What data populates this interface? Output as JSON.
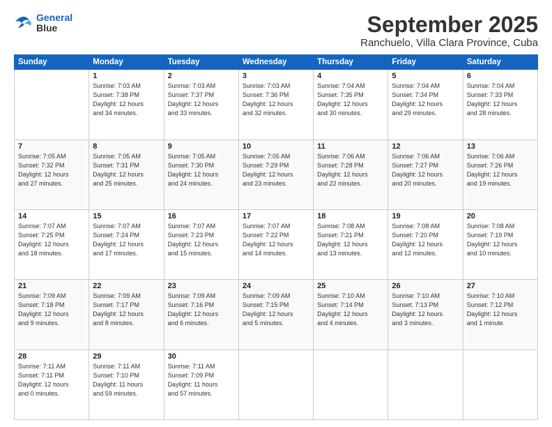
{
  "logo": {
    "line1": "General",
    "line2": "Blue"
  },
  "title": "September 2025",
  "subtitle": "Ranchuelo, Villa Clara Province, Cuba",
  "weekdays": [
    "Sunday",
    "Monday",
    "Tuesday",
    "Wednesday",
    "Thursday",
    "Friday",
    "Saturday"
  ],
  "weeks": [
    [
      {
        "day": "",
        "info": ""
      },
      {
        "day": "1",
        "info": "Sunrise: 7:03 AM\nSunset: 7:38 PM\nDaylight: 12 hours\nand 34 minutes."
      },
      {
        "day": "2",
        "info": "Sunrise: 7:03 AM\nSunset: 7:37 PM\nDaylight: 12 hours\nand 33 minutes."
      },
      {
        "day": "3",
        "info": "Sunrise: 7:03 AM\nSunset: 7:36 PM\nDaylight: 12 hours\nand 32 minutes."
      },
      {
        "day": "4",
        "info": "Sunrise: 7:04 AM\nSunset: 7:35 PM\nDaylight: 12 hours\nand 30 minutes."
      },
      {
        "day": "5",
        "info": "Sunrise: 7:04 AM\nSunset: 7:34 PM\nDaylight: 12 hours\nand 29 minutes."
      },
      {
        "day": "6",
        "info": "Sunrise: 7:04 AM\nSunset: 7:33 PM\nDaylight: 12 hours\nand 28 minutes."
      }
    ],
    [
      {
        "day": "7",
        "info": "Sunrise: 7:05 AM\nSunset: 7:32 PM\nDaylight: 12 hours\nand 27 minutes."
      },
      {
        "day": "8",
        "info": "Sunrise: 7:05 AM\nSunset: 7:31 PM\nDaylight: 12 hours\nand 25 minutes."
      },
      {
        "day": "9",
        "info": "Sunrise: 7:05 AM\nSunset: 7:30 PM\nDaylight: 12 hours\nand 24 minutes."
      },
      {
        "day": "10",
        "info": "Sunrise: 7:05 AM\nSunset: 7:29 PM\nDaylight: 12 hours\nand 23 minutes."
      },
      {
        "day": "11",
        "info": "Sunrise: 7:06 AM\nSunset: 7:28 PM\nDaylight: 12 hours\nand 22 minutes."
      },
      {
        "day": "12",
        "info": "Sunrise: 7:06 AM\nSunset: 7:27 PM\nDaylight: 12 hours\nand 20 minutes."
      },
      {
        "day": "13",
        "info": "Sunrise: 7:06 AM\nSunset: 7:26 PM\nDaylight: 12 hours\nand 19 minutes."
      }
    ],
    [
      {
        "day": "14",
        "info": "Sunrise: 7:07 AM\nSunset: 7:25 PM\nDaylight: 12 hours\nand 18 minutes."
      },
      {
        "day": "15",
        "info": "Sunrise: 7:07 AM\nSunset: 7:24 PM\nDaylight: 12 hours\nand 17 minutes."
      },
      {
        "day": "16",
        "info": "Sunrise: 7:07 AM\nSunset: 7:23 PM\nDaylight: 12 hours\nand 15 minutes."
      },
      {
        "day": "17",
        "info": "Sunrise: 7:07 AM\nSunset: 7:22 PM\nDaylight: 12 hours\nand 14 minutes."
      },
      {
        "day": "18",
        "info": "Sunrise: 7:08 AM\nSunset: 7:21 PM\nDaylight: 12 hours\nand 13 minutes."
      },
      {
        "day": "19",
        "info": "Sunrise: 7:08 AM\nSunset: 7:20 PM\nDaylight: 12 hours\nand 12 minutes."
      },
      {
        "day": "20",
        "info": "Sunrise: 7:08 AM\nSunset: 7:19 PM\nDaylight: 12 hours\nand 10 minutes."
      }
    ],
    [
      {
        "day": "21",
        "info": "Sunrise: 7:09 AM\nSunset: 7:18 PM\nDaylight: 12 hours\nand 9 minutes."
      },
      {
        "day": "22",
        "info": "Sunrise: 7:09 AM\nSunset: 7:17 PM\nDaylight: 12 hours\nand 8 minutes."
      },
      {
        "day": "23",
        "info": "Sunrise: 7:09 AM\nSunset: 7:16 PM\nDaylight: 12 hours\nand 6 minutes."
      },
      {
        "day": "24",
        "info": "Sunrise: 7:09 AM\nSunset: 7:15 PM\nDaylight: 12 hours\nand 5 minutes."
      },
      {
        "day": "25",
        "info": "Sunrise: 7:10 AM\nSunset: 7:14 PM\nDaylight: 12 hours\nand 4 minutes."
      },
      {
        "day": "26",
        "info": "Sunrise: 7:10 AM\nSunset: 7:13 PM\nDaylight: 12 hours\nand 3 minutes."
      },
      {
        "day": "27",
        "info": "Sunrise: 7:10 AM\nSunset: 7:12 PM\nDaylight: 12 hours\nand 1 minute."
      }
    ],
    [
      {
        "day": "28",
        "info": "Sunrise: 7:11 AM\nSunset: 7:11 PM\nDaylight: 12 hours\nand 0 minutes."
      },
      {
        "day": "29",
        "info": "Sunrise: 7:11 AM\nSunset: 7:10 PM\nDaylight: 11 hours\nand 59 minutes."
      },
      {
        "day": "30",
        "info": "Sunrise: 7:11 AM\nSunset: 7:09 PM\nDaylight: 11 hours\nand 57 minutes."
      },
      {
        "day": "",
        "info": ""
      },
      {
        "day": "",
        "info": ""
      },
      {
        "day": "",
        "info": ""
      },
      {
        "day": "",
        "info": ""
      }
    ]
  ]
}
